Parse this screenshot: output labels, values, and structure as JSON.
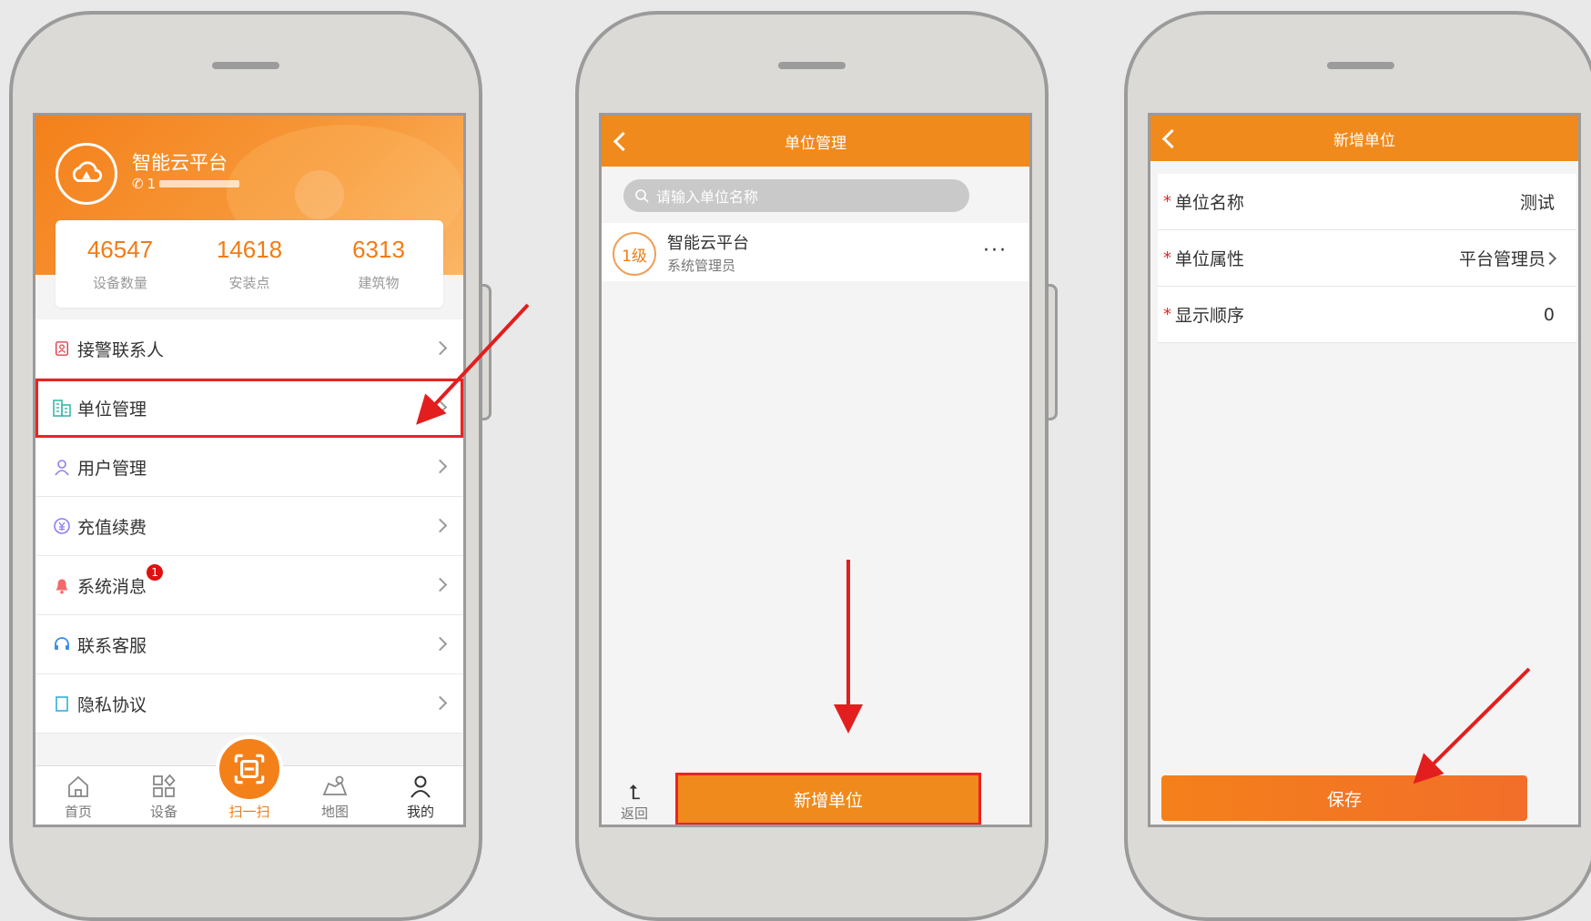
{
  "screen1": {
    "app_name": "智能云平台",
    "phone_prefix": "1",
    "stats": [
      {
        "value": "46547",
        "label": "设备数量"
      },
      {
        "value": "14618",
        "label": "安装点"
      },
      {
        "value": "6313",
        "label": "建筑物"
      }
    ],
    "menu": [
      {
        "label": "接警联系人",
        "icon": "contact-card-icon"
      },
      {
        "label": "单位管理",
        "icon": "building-icon"
      },
      {
        "label": "用户管理",
        "icon": "user-icon"
      },
      {
        "label": "充值续费",
        "icon": "yen-coin-icon"
      },
      {
        "label": "系统消息",
        "icon": "bell-icon",
        "badge": "1"
      },
      {
        "label": "联系客服",
        "icon": "headset-icon"
      },
      {
        "label": "隐私协议",
        "icon": "document-icon"
      }
    ],
    "tabs": [
      {
        "label": "首页",
        "icon": "home-icon"
      },
      {
        "label": "设备",
        "icon": "devices-icon"
      },
      {
        "label": "扫一扫",
        "icon": "scan-icon"
      },
      {
        "label": "地图",
        "icon": "map-icon"
      },
      {
        "label": "我的",
        "icon": "profile-icon"
      }
    ]
  },
  "screen2": {
    "title": "单位管理",
    "search_placeholder": "请输入单位名称",
    "unit": {
      "level": "1级",
      "name": "智能云平台",
      "role": "系统管理员",
      "more": "···"
    },
    "back_label": "返回",
    "add_button": "新增单位"
  },
  "screen3": {
    "title": "新增单位",
    "fields": [
      {
        "label": "单位名称",
        "value": "测试",
        "required": "*"
      },
      {
        "label": "单位属性",
        "value": "平台管理员",
        "required": "*"
      },
      {
        "label": "显示顺序",
        "value": "0",
        "required": "*"
      }
    ],
    "save_button": "保存"
  },
  "colors": {
    "accent": "#f08a1c",
    "highlight": "#e22222",
    "badge": "#e01010"
  }
}
